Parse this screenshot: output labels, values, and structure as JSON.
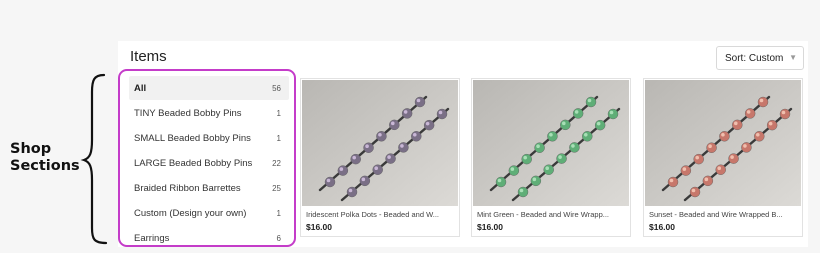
{
  "annotation": {
    "label_line1": "Shop",
    "label_line2": "Sections"
  },
  "shop": {
    "title": "Items",
    "sort": {
      "label": "Sort: Custom",
      "caret_icon": "chevron-down-icon"
    },
    "sections": [
      {
        "label": "All",
        "count": "56",
        "active": true
      },
      {
        "label": "TINY Beaded Bobby Pins",
        "count": "1",
        "active": false
      },
      {
        "label": "SMALL Beaded Bobby Pins",
        "count": "1",
        "active": false
      },
      {
        "label": "LARGE Beaded Bobby Pins",
        "count": "22",
        "active": false
      },
      {
        "label": "Braided Ribbon Barrettes",
        "count": "25",
        "active": false
      },
      {
        "label": "Custom (Design your own)",
        "count": "1",
        "active": false
      },
      {
        "label": "Earrings",
        "count": "6",
        "active": false
      }
    ],
    "listings": [
      {
        "title": "Iridescent Polka Dots - Beaded and W...",
        "price": "$16.00",
        "bead_color": "#7a6f86",
        "bead_highlight": "#c9b7d6"
      },
      {
        "title": "Mint Green - Beaded and Wire Wrapp...",
        "price": "$16.00",
        "bead_color": "#5fae77",
        "bead_highlight": "#a8dfb6"
      },
      {
        "title": "Sunset - Beaded and Wire Wrapped B...",
        "price": "$16.00",
        "bead_color": "#c7776b",
        "bead_highlight": "#f0bfae"
      }
    ],
    "highlight_color": "#c43cc9"
  }
}
